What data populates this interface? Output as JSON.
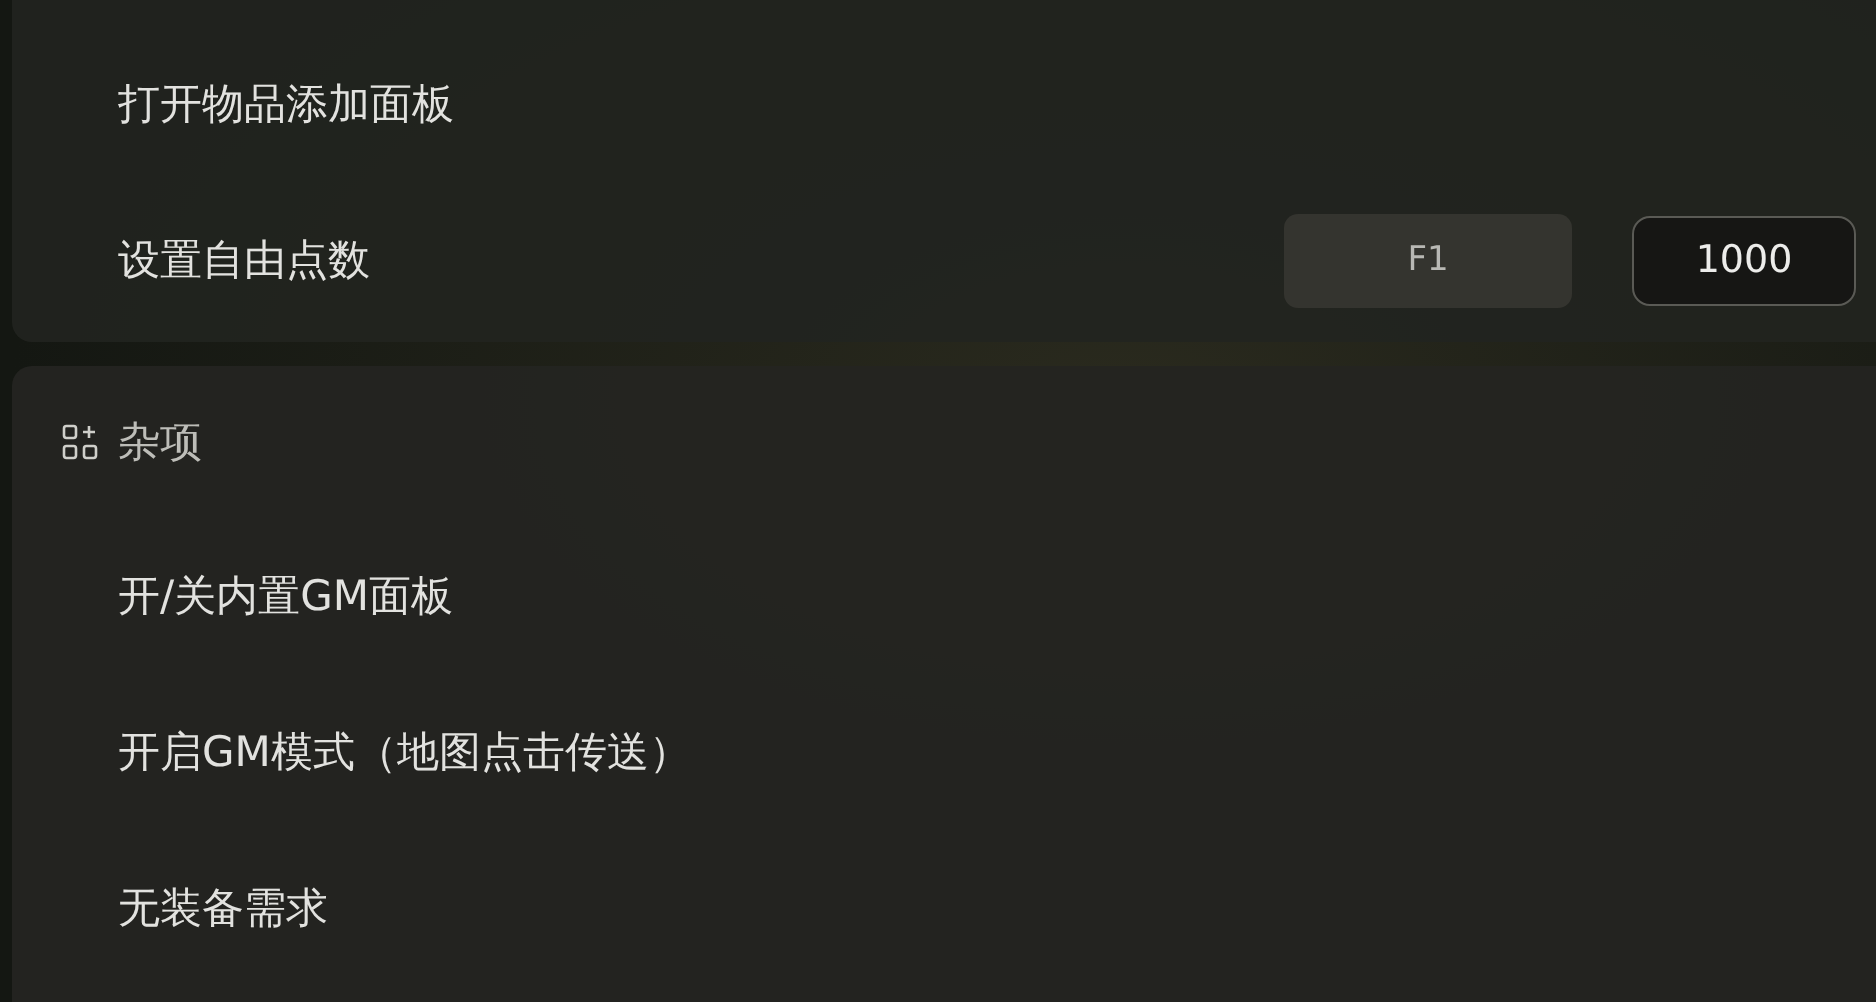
{
  "sections": [
    {
      "items": [
        {
          "kind": "action",
          "label": "打开物品添加面板"
        },
        {
          "kind": "hotkey",
          "label": "设置自由点数",
          "key": "F1",
          "value": "1000"
        }
      ]
    },
    {
      "title": "杂项",
      "items": [
        {
          "kind": "action",
          "label": "开/关内置GM面板"
        },
        {
          "kind": "action",
          "label": "开启GM模式（地图点击传送）"
        },
        {
          "kind": "action",
          "label": "无装备需求"
        }
      ]
    }
  ]
}
